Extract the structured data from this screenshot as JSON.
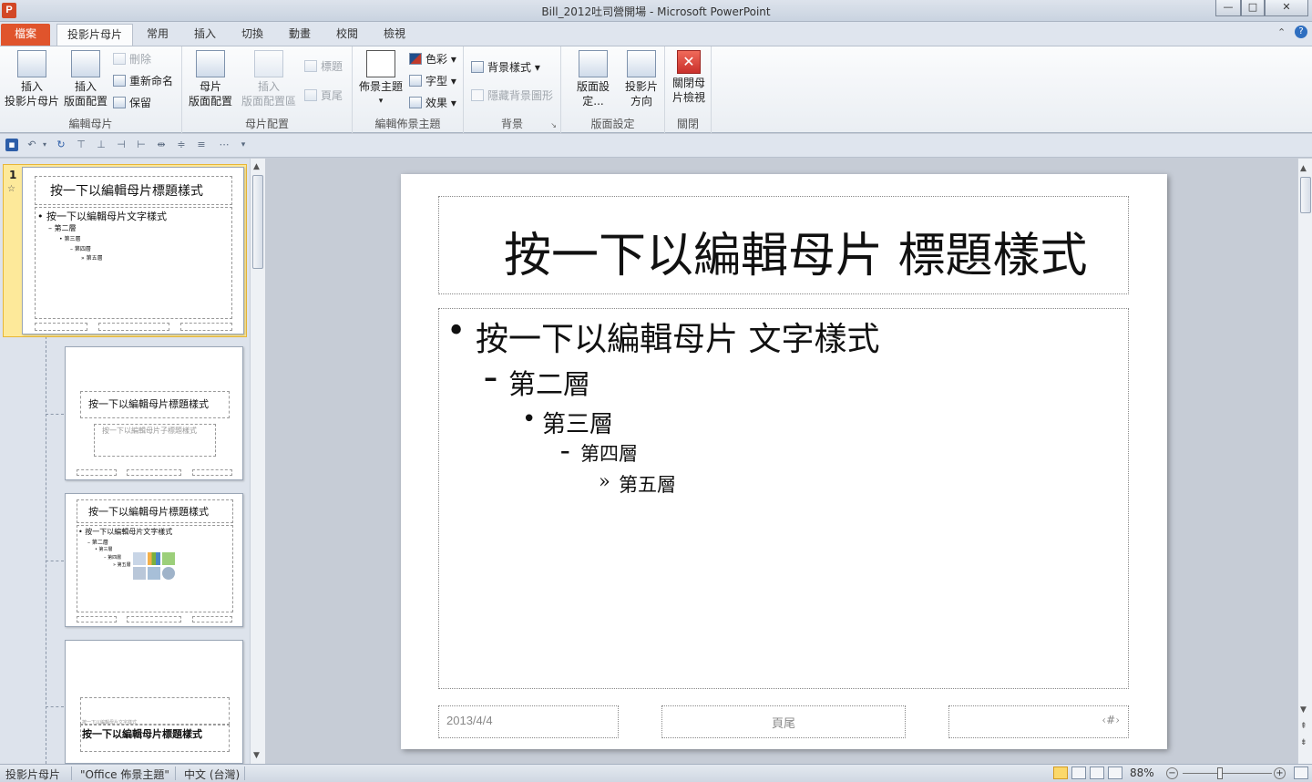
{
  "window": {
    "title": "Bill_2012吐司營開場 - Microsoft PowerPoint",
    "app_icon": "P",
    "minimize": "—",
    "maximize": "□",
    "close": "✕"
  },
  "tabs": [
    {
      "label": "檔案"
    },
    {
      "label": "投影片母片"
    },
    {
      "label": "常用"
    },
    {
      "label": "插入"
    },
    {
      "label": "切換"
    },
    {
      "label": "動畫"
    },
    {
      "label": "校閱"
    },
    {
      "label": "檢視"
    }
  ],
  "ribbon": {
    "groups": {
      "edit_master": "編輯母片",
      "master_layout": "母片配置",
      "edit_theme": "編輯佈景主題",
      "background": "背景",
      "page_setup": "版面設定",
      "close": "關閉"
    },
    "insert_slide_master": [
      "插入",
      "投影片母片"
    ],
    "insert_layout": [
      "插入",
      "版面配置"
    ],
    "delete": "刪除",
    "rename": "重新命名",
    "preserve": "保留",
    "master_layout_btn": [
      "母片",
      "版面配置"
    ],
    "insert_placeholder": [
      "插入",
      "版面配置區"
    ],
    "title_check": "標題",
    "footer_check": "頁尾",
    "themes": [
      "佈景主題",
      "▾"
    ],
    "colors": "色彩",
    "fonts": "字型",
    "effects": "效果",
    "background_styles": "背景樣式",
    "hide_bg": "隱藏背景圖形",
    "page_setup_btn": [
      "版面設定..."
    ],
    "slide_orientation": [
      "投影片",
      "方向"
    ],
    "close_master": [
      "關閉母",
      "片檢視"
    ]
  },
  "thumbs": {
    "number": "1",
    "t1_title": "按一下以編輯母片標題樣式",
    "t1_body": [
      "• 按一下以編輯母片文字樣式",
      "– 第二層",
      "• 第三層",
      "– 第四層",
      "» 第五層"
    ],
    "t2_title": "按一下以編輯母片標題樣式",
    "t2_sub": "按一下以編輯母片子標題樣式",
    "t3_title": "按一下以編輯母片標題樣式",
    "t3_body": [
      "• 按一下以編輯母片文字樣式",
      "– 第二層",
      "• 第三層",
      "– 第四層",
      "» 第五層"
    ],
    "t4_small": "按一下以編輯母片文字樣式",
    "t4_title": "按一下以編輯母片標題樣式"
  },
  "slide": {
    "title": "按一下以編輯母片 標題樣式",
    "body": [
      {
        "bullet": "•",
        "text": "按一下以編輯母片 文字樣式"
      },
      {
        "bullet": "–",
        "text": "第二層"
      },
      {
        "bullet": "•",
        "text": "第三層"
      },
      {
        "bullet": "–",
        "text": "第四層"
      },
      {
        "bullet": "»",
        "text": "第五層"
      }
    ],
    "date": "2013/4/4",
    "footer": "頁尾",
    "number": "‹#›"
  },
  "status": {
    "view": "投影片母片",
    "theme": "\"Office 佈景主題\"",
    "language": "中文 (台灣)",
    "zoom": "88%"
  }
}
